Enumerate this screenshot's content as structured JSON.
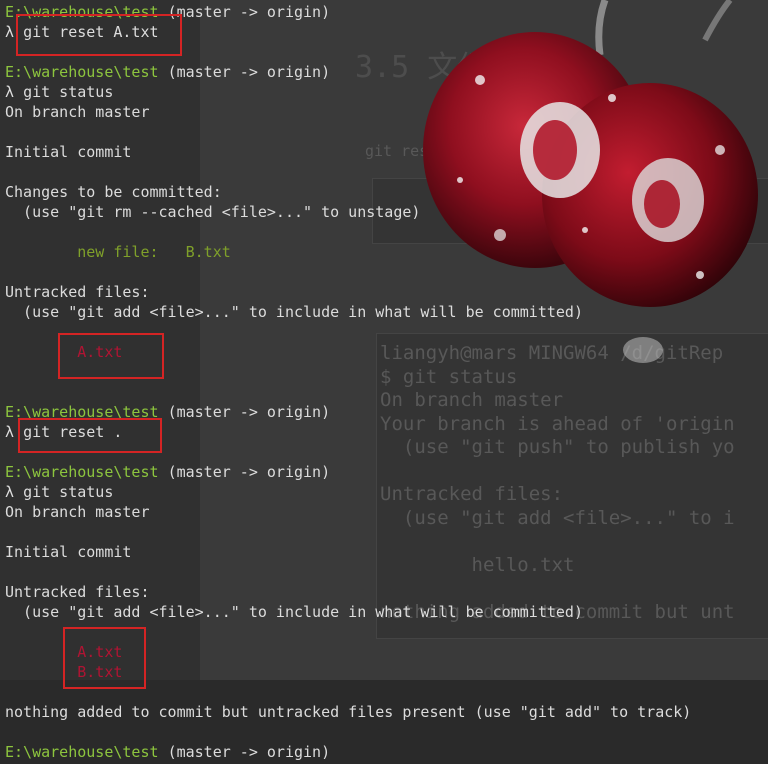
{
  "prompt": {
    "path": "E:\\warehouse\\test",
    "branch": "(master -> origin)",
    "symbol": "λ"
  },
  "commands": {
    "c1": "git reset A.txt",
    "c2": "git status",
    "c3": "git reset .",
    "c4": "git status"
  },
  "output1": {
    "on_branch": "On branch master",
    "initial": "Initial commit",
    "changes_header": "Changes to be committed:",
    "unstage_hint": "  (use \"git rm --cached <file>...\" to unstage)",
    "new_file_label": "        new file:   ",
    "new_file_name": "B.txt",
    "untracked_header": "Untracked files:",
    "include_hint": "  (use \"git add <file>...\" to include in what will be committed)",
    "untracked": [
      "        A.txt"
    ]
  },
  "output2": {
    "on_branch": "On branch master",
    "initial": "Initial commit",
    "untracked_header": "Untracked files:",
    "include_hint": "  (use \"git add <file>...\" to include in what will be committed)",
    "untracked": [
      "        A.txt",
      "        B.txt"
    ],
    "nothing_added": "nothing added to commit but untracked files present (use \"git add\" to track)"
  },
  "background": {
    "heading": "3.5 文件撤销",
    "subtitle": "git reset 是将暂存区中的文件恢复到工作区",
    "code_lines": [
      "liangyh@mars MINGW64 /d/gitRep",
      "$ git status",
      "On branch master",
      "Your branch is ahead of 'origin",
      "  (use \"git push\" to publish yo",
      "",
      "Untracked files:",
      "  (use \"git add <file>...\" to i",
      "",
      "        hello.txt",
      "",
      "nothing added to commit but unt"
    ]
  },
  "colors": {
    "path": "#8dc53e",
    "staged": "#7fa02a",
    "untracked": "#b01433",
    "highlight": "#d42424",
    "text": "#dcdcdc"
  }
}
